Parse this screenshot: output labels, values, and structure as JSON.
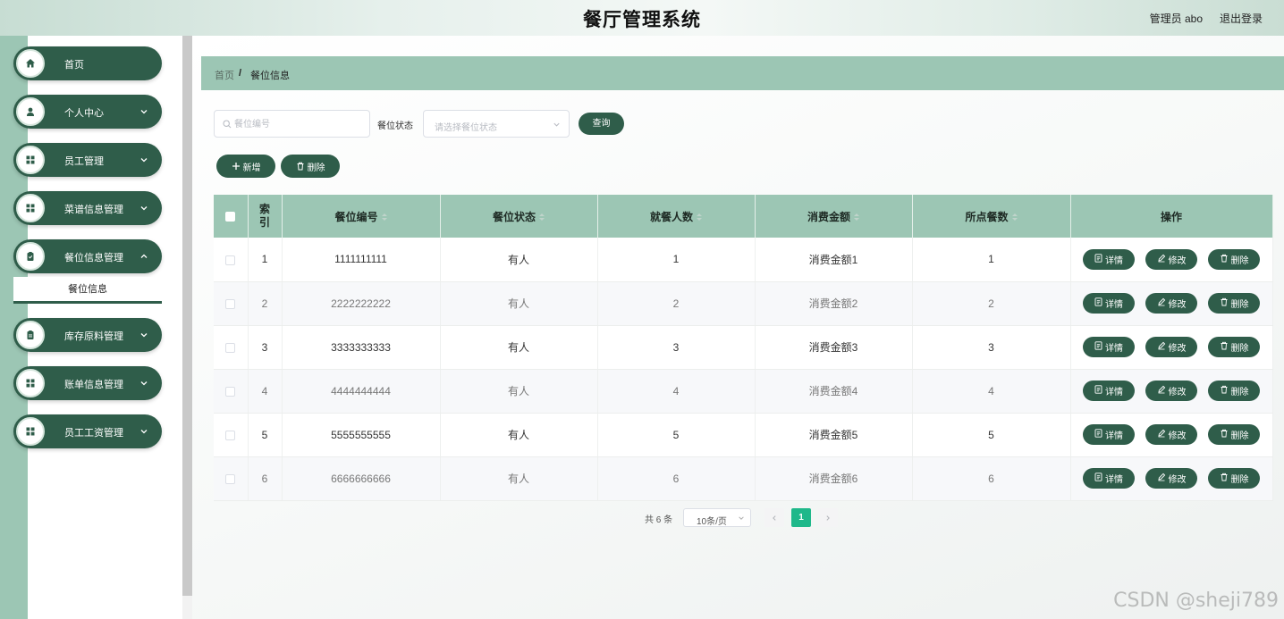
{
  "header": {
    "title": "餐厅管理系统",
    "user": "管理员 abo",
    "logout": "退出登录"
  },
  "sidebar": {
    "items": [
      {
        "label": "首页",
        "icon": "home-icon"
      },
      {
        "label": "个人中心",
        "icon": "user-icon"
      },
      {
        "label": "员工管理",
        "icon": "grid-icon"
      },
      {
        "label": "菜谱信息管理",
        "icon": "grid-icon"
      },
      {
        "label": "餐位信息管理",
        "icon": "clipboard-icon"
      },
      {
        "label": "库存原料管理",
        "icon": "clipboard-icon"
      },
      {
        "label": "账单信息管理",
        "icon": "grid-icon"
      },
      {
        "label": "员工工资管理",
        "icon": "grid-icon"
      }
    ],
    "submenu": "餐位信息"
  },
  "breadcrumb": {
    "home": "首页",
    "sep": "/",
    "current": "餐位信息"
  },
  "search": {
    "placeholder": "餐位编号",
    "status_label": "餐位状态",
    "status_placeholder": "请选择餐位状态",
    "query_label": "查询"
  },
  "actions": {
    "add": "新增",
    "delete": "删除"
  },
  "table": {
    "columns": [
      "索引",
      "餐位编号",
      "餐位状态",
      "就餐人数",
      "消费金额",
      "所点餐数",
      "操作"
    ],
    "rows": [
      {
        "index": "1",
        "code": "1111111111",
        "status": "有人",
        "people": "1",
        "amount": "消费金额1",
        "dishes": "1"
      },
      {
        "index": "2",
        "code": "2222222222",
        "status": "有人",
        "people": "2",
        "amount": "消费金额2",
        "dishes": "2"
      },
      {
        "index": "3",
        "code": "3333333333",
        "status": "有人",
        "people": "3",
        "amount": "消费金额3",
        "dishes": "3"
      },
      {
        "index": "4",
        "code": "4444444444",
        "status": "有人",
        "people": "4",
        "amount": "消费金额4",
        "dishes": "4"
      },
      {
        "index": "5",
        "code": "5555555555",
        "status": "有人",
        "people": "5",
        "amount": "消费金额5",
        "dishes": "5"
      },
      {
        "index": "6",
        "code": "6666666666",
        "status": "有人",
        "people": "6",
        "amount": "消费金额6",
        "dishes": "6"
      }
    ],
    "row_actions": {
      "detail": "详情",
      "edit": "修改",
      "delete": "删除"
    }
  },
  "pagination": {
    "total": "共 6 条",
    "page_size": "10条/页",
    "current_page": "1"
  },
  "watermark": "CSDN @sheji789",
  "colors": {
    "primary": "#2f5d4a",
    "accent": "#9cc6b4",
    "page_active": "#1fb88a"
  }
}
